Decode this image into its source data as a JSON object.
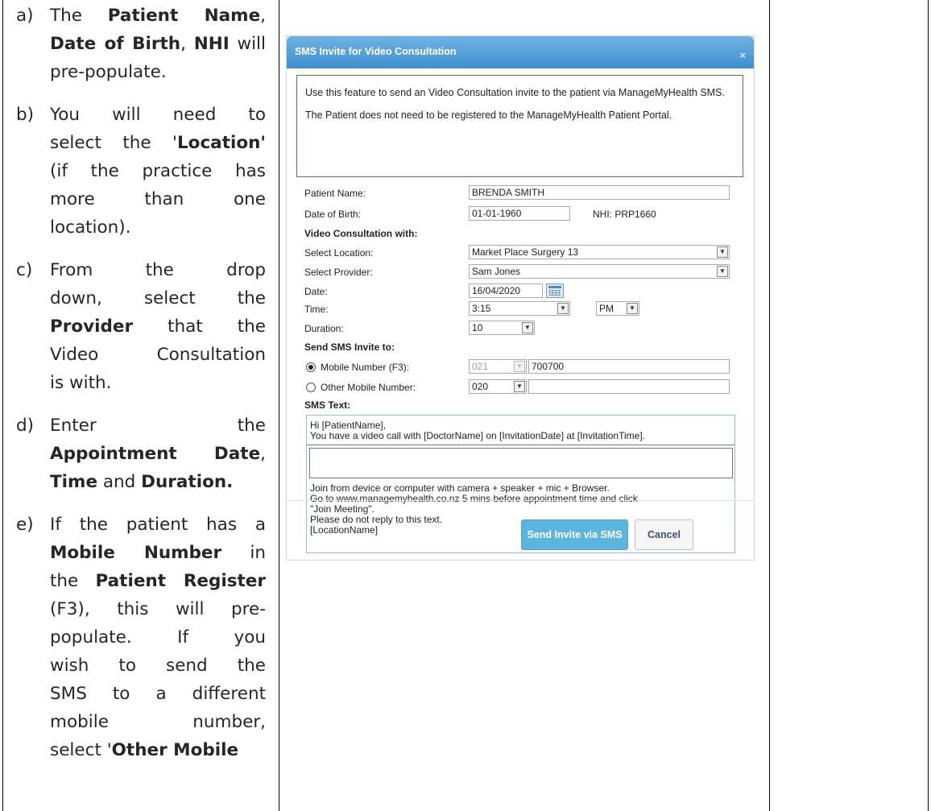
{
  "instructions": [
    {
      "marker": "a)",
      "lines": [
        [
          {
            "t": "The "
          },
          {
            "t": "Patient Name",
            "b": true
          },
          {
            "t": ","
          }
        ],
        [
          {
            "t": "Date of Birth",
            "b": true
          },
          {
            "t": ", "
          },
          {
            "t": "NHI",
            "b": true
          },
          {
            "t": " will"
          }
        ],
        [
          {
            "t": "pre-populate."
          }
        ]
      ]
    },
    {
      "marker": "b)",
      "lines": [
        [
          {
            "t": "You will need to"
          }
        ],
        [
          {
            "t": "select the '"
          },
          {
            "t": "Location'",
            "b": true
          }
        ],
        [
          {
            "t": "(if the practice has"
          }
        ],
        [
          {
            "t": "more than one"
          }
        ],
        [
          {
            "t": "location)."
          }
        ]
      ]
    },
    {
      "marker": "c)",
      "lines": [
        [
          {
            "t": "From the drop"
          }
        ],
        [
          {
            "t": "down, select the"
          }
        ],
        [
          {
            "t": "Provider",
            "b": true
          },
          {
            "t": " that the"
          }
        ],
        [
          {
            "t": "Video Consultation"
          }
        ],
        [
          {
            "t": "is with."
          }
        ]
      ]
    },
    {
      "marker": "d)",
      "lines": [
        [
          {
            "t": "Enter the"
          }
        ],
        [
          {
            "t": "Appointment Date",
            "b": true
          },
          {
            "t": ","
          }
        ],
        [
          {
            "t": "Time",
            "b": true
          },
          {
            "t": " and "
          },
          {
            "t": "Duration.",
            "b": true
          }
        ]
      ]
    },
    {
      "marker": "e)",
      "lines": [
        [
          {
            "t": "If the patient has a"
          }
        ],
        [
          {
            "t": "Mobile Number",
            "b": true
          },
          {
            "t": " in"
          }
        ],
        [
          {
            "t": "the "
          },
          {
            "t": "Patient Register",
            "b": true
          }
        ],
        [
          {
            "t": "(F3), this will pre-"
          }
        ],
        [
          {
            "t": "populate. If you"
          }
        ],
        [
          {
            "t": "wish to send the"
          }
        ],
        [
          {
            "t": "SMS to a different"
          }
        ],
        [
          {
            "t": "mobile number,"
          }
        ],
        [
          {
            "t": "select '"
          },
          {
            "t": "Other Mobile",
            "b": true
          }
        ]
      ]
    }
  ],
  "dialog": {
    "title": "SMS Invite for Video Consultation",
    "close_glyph": "×",
    "notice_p1": "Use this feature to send an Video Consultation invite to the patient via ManageMyHealth SMS.",
    "notice_p2": "The Patient does not need to be registered to the ManageMyHealth Patient Portal.",
    "patient_name_label": "Patient Name:",
    "patient_name_value": "BRENDA SMITH",
    "dob_label": "Date of Birth:",
    "dob_value": "01-01-1960",
    "nhi_text": "NHI: PRP1660",
    "video_with_heading": "Video Consultation with:",
    "location_label": "Select Location:",
    "location_value": "Market Place Surgery 13",
    "provider_label": "Select Provider:",
    "provider_value": "Sam Jones",
    "date_label": "Date:",
    "date_value": "16/04/2020",
    "time_label": "Time:",
    "time_value": "3:15",
    "ampm_value": "PM",
    "duration_label": "Duration:",
    "duration_value": "10",
    "send_to_heading": "Send SMS Invite to:",
    "mobile_label": "Mobile Number (F3):",
    "mobile_prefix": "021",
    "mobile_value": "700700",
    "other_mobile_label": "Other Mobile Number:",
    "other_prefix": "020",
    "other_value": "",
    "sms_text_heading": "SMS Text:",
    "sms_line1": "Hi [PatientName],",
    "sms_line2": "You have a video call with [DoctorName] on [InvitationDate] at [InvitationTime].",
    "sms_line3": "Join from device or computer with camera + speaker + mic + Browser.",
    "sms_line4": "Go to www.managemyhealth.co.nz 5 mins before appointment time and click",
    "sms_line5": "\"Join Meeting\".",
    "sms_line6": "Please do not reply to this text.",
    "sms_line7": "[LocationName]",
    "send_button": "Send Invite via SMS",
    "cancel_button": "Cancel",
    "dropdown_glyph": "▼"
  }
}
